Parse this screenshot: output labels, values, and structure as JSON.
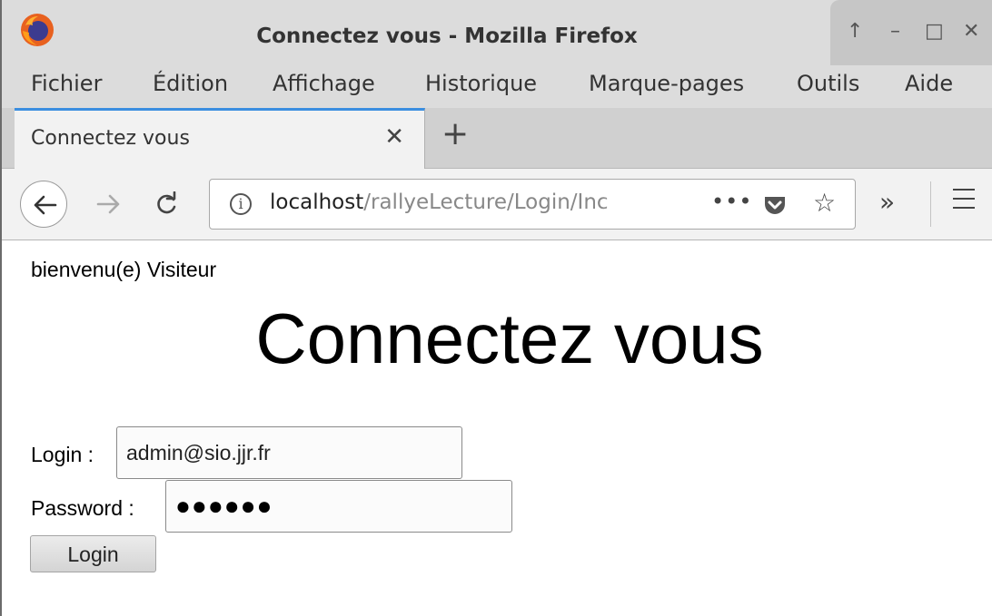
{
  "window": {
    "title": "Connectez vous - Mozilla Firefox",
    "controls": [
      "↑",
      "–",
      "□",
      "✕"
    ]
  },
  "menubar": {
    "items": [
      "Fichier",
      "Édition",
      "Affichage",
      "Historique",
      "Marque-pages",
      "Outils",
      "Aide"
    ]
  },
  "tabs": [
    {
      "label": "Connectez vous",
      "active": true
    }
  ],
  "navbar": {
    "url_host": "localhost",
    "url_path": "/rallyeLecture/Login/Inc",
    "page_actions": "•••"
  },
  "page": {
    "welcome": "bienvenu(e) Visiteur",
    "title": "Connectez vous",
    "login_label": "Login :",
    "login_value": "admin@sio.jjr.fr",
    "password_label": "Password :",
    "password_mask": "●●●●●●",
    "submit_label": "Login"
  },
  "colors": {
    "tab_accent": "#3b8ee0",
    "chrome": "#dcdcdc"
  },
  "icons": [
    "firefox-logo-icon",
    "back-arrow-icon",
    "forward-arrow-icon",
    "reload-icon",
    "info-icon",
    "pocket-icon",
    "star-icon",
    "overflow-chevron-icon",
    "hamburger-menu-icon",
    "close-icon",
    "plus-icon"
  ]
}
